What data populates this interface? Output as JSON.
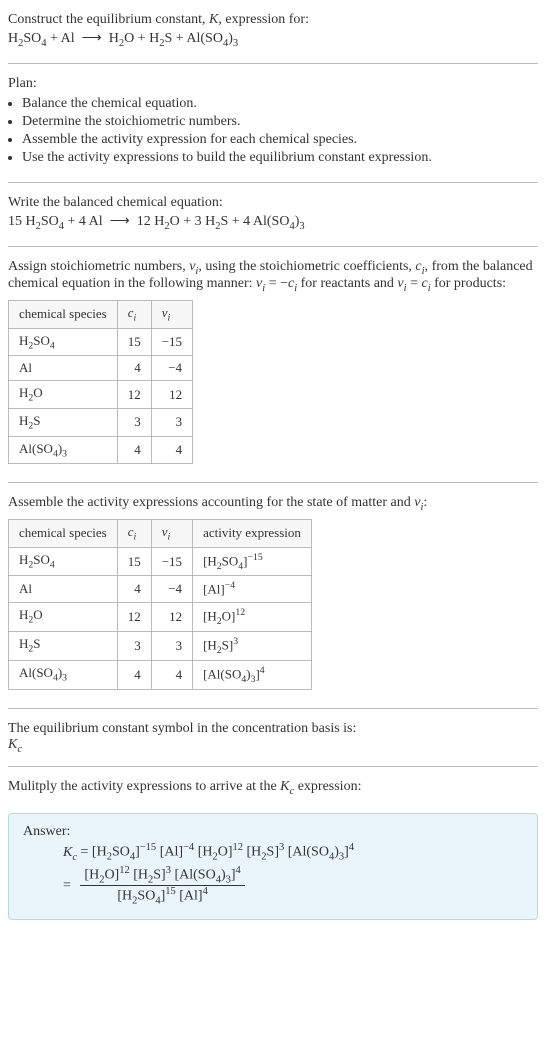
{
  "intro": {
    "line1a": "Construct the equilibrium constant, ",
    "line1b": ", expression for:",
    "equation_html": "H<sub>2</sub>SO<sub>4</sub> + Al&nbsp;&nbsp;⟶&nbsp;&nbsp;H<sub>2</sub>O + H<sub>2</sub>S + Al(SO<sub>4</sub>)<sub>3</sub>"
  },
  "plan": {
    "heading": "Plan:",
    "items": [
      "Balance the chemical equation.",
      "Determine the stoichiometric numbers.",
      "Assemble the activity expression for each chemical species.",
      "Use the activity expressions to build the equilibrium constant expression."
    ]
  },
  "balanced": {
    "heading": "Write the balanced chemical equation:",
    "equation_html": "15 H<sub>2</sub>SO<sub>4</sub> + 4 Al&nbsp;&nbsp;⟶&nbsp;&nbsp;12 H<sub>2</sub>O + 3 H<sub>2</sub>S + 4 Al(SO<sub>4</sub>)<sub>3</sub>"
  },
  "assign": {
    "text_html": "Assign stoichiometric numbers, <span class=\"ital\">ν<sub>i</sub></span>, using the stoichiometric coefficients, <span class=\"ital\">c<sub>i</sub></span>, from the balanced chemical equation in the following manner: <span class=\"ital\">ν<sub>i</sub></span> = −<span class=\"ital\">c<sub>i</sub></span> for reactants and <span class=\"ital\">ν<sub>i</sub></span> = <span class=\"ital\">c<sub>i</sub></span> for products:",
    "headers": {
      "species": "chemical species",
      "ci": "c_i",
      "vi": "ν_i"
    },
    "rows": [
      {
        "species_html": "H<sub>2</sub>SO<sub>4</sub>",
        "ci": "15",
        "vi": "−15"
      },
      {
        "species_html": "Al",
        "ci": "4",
        "vi": "−4"
      },
      {
        "species_html": "H<sub>2</sub>O",
        "ci": "12",
        "vi": "12"
      },
      {
        "species_html": "H<sub>2</sub>S",
        "ci": "3",
        "vi": "3"
      },
      {
        "species_html": "Al(SO<sub>4</sub>)<sub>3</sub>",
        "ci": "4",
        "vi": "4"
      }
    ]
  },
  "activity": {
    "heading_html": "Assemble the activity expressions accounting for the state of matter and <span class=\"ital\">ν<sub>i</sub></span>:",
    "headers": {
      "species": "chemical species",
      "ci": "c_i",
      "vi": "ν_i",
      "act": "activity expression"
    },
    "rows": [
      {
        "species_html": "H<sub>2</sub>SO<sub>4</sub>",
        "ci": "15",
        "vi": "−15",
        "act_html": "[H<sub>2</sub>SO<sub>4</sub>]<sup>−15</sup>"
      },
      {
        "species_html": "Al",
        "ci": "4",
        "vi": "−4",
        "act_html": "[Al]<sup>−4</sup>"
      },
      {
        "species_html": "H<sub>2</sub>O",
        "ci": "12",
        "vi": "12",
        "act_html": "[H<sub>2</sub>O]<sup>12</sup>"
      },
      {
        "species_html": "H<sub>2</sub>S",
        "ci": "3",
        "vi": "3",
        "act_html": "[H<sub>2</sub>S]<sup>3</sup>"
      },
      {
        "species_html": "Al(SO<sub>4</sub>)<sub>3</sub>",
        "ci": "4",
        "vi": "4",
        "act_html": "[Al(SO<sub>4</sub>)<sub>3</sub>]<sup>4</sup>"
      }
    ]
  },
  "basis": {
    "line1": "The equilibrium constant symbol in the concentration basis is:",
    "symbol_html": "<span class=\"ital\">K<sub>c</sub></span>"
  },
  "multiply": {
    "text_html": "Mulitply the activity expressions to arrive at the <span class=\"ital\">K<sub>c</sub></span> expression:"
  },
  "answer": {
    "label": "Answer:",
    "line1_html": "<span class=\"ital\">K<sub>c</sub></span> = [H<sub>2</sub>SO<sub>4</sub>]<sup>−15</sup> [Al]<sup>−4</sup> [H<sub>2</sub>O]<sup>12</sup> [H<sub>2</sub>S]<sup>3</sup> [Al(SO<sub>4</sub>)<sub>3</sub>]<sup>4</sup>",
    "frac_num_html": "[H<sub>2</sub>O]<sup>12</sup> [H<sub>2</sub>S]<sup>3</sup> [Al(SO<sub>4</sub>)<sub>3</sub>]<sup>4</sup>",
    "frac_den_html": "[H<sub>2</sub>SO<sub>4</sub>]<sup>15</sup> [Al]<sup>4</sup>"
  }
}
